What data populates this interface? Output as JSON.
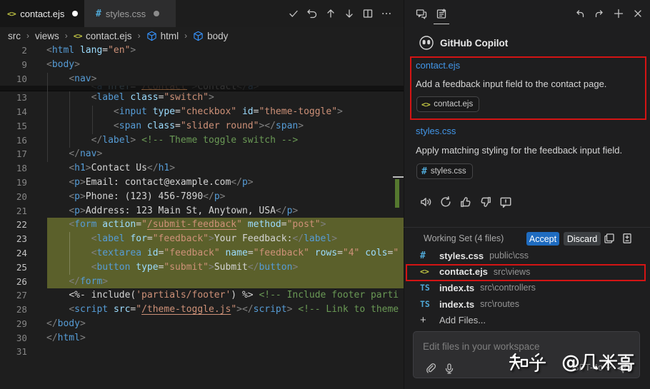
{
  "editor": {
    "tabs": [
      {
        "name": "contact.ejs",
        "icon": "ejs",
        "modified": true,
        "active": true
      },
      {
        "name": "styles.css",
        "icon": "css",
        "modified": true,
        "active": false
      }
    ],
    "toolbar_icons": [
      "check-icon",
      "discard-icon",
      "arrow-up-icon",
      "arrow-down-icon",
      "split-editor-icon",
      "more-actions-icon"
    ],
    "breadcrumb": [
      "src",
      "views",
      "contact.ejs",
      "html",
      "body"
    ],
    "breadcrumb_icons": {
      "contact.ejs": "ejs",
      "html": "cube",
      "body": "cube"
    },
    "code_lines": [
      {
        "n": "2",
        "hl": false,
        "tokens": [
          [
            "p",
            "<"
          ],
          [
            "t",
            "html"
          ],
          [
            "o",
            " "
          ],
          [
            "a",
            "lang"
          ],
          [
            "o",
            "="
          ],
          [
            "s",
            "\"en\""
          ],
          [
            "p",
            ">"
          ]
        ]
      },
      {
        "n": "9",
        "hl": false,
        "tokens": [
          [
            "p",
            "<"
          ],
          [
            "t",
            "body"
          ],
          [
            "p",
            ">"
          ]
        ]
      },
      {
        "n": "10",
        "hl": false,
        "tokens": [
          [
            "x",
            "    "
          ],
          [
            "p",
            "<"
          ],
          [
            "t",
            "nav"
          ],
          [
            "p",
            ">"
          ]
        ]
      },
      {
        "n": "13",
        "hl": false,
        "tokens": [
          [
            "x",
            "        "
          ],
          [
            "p",
            "<"
          ],
          [
            "t",
            "label"
          ],
          [
            "o",
            " "
          ],
          [
            "a",
            "class"
          ],
          [
            "o",
            "="
          ],
          [
            "s",
            "\"switch\""
          ],
          [
            "p",
            ">"
          ]
        ]
      },
      {
        "n": "14",
        "hl": false,
        "tokens": [
          [
            "x",
            "            "
          ],
          [
            "p",
            "<"
          ],
          [
            "t",
            "input"
          ],
          [
            "o",
            " "
          ],
          [
            "a",
            "type"
          ],
          [
            "o",
            "="
          ],
          [
            "s",
            "\"checkbox\""
          ],
          [
            "o",
            " "
          ],
          [
            "a",
            "id"
          ],
          [
            "o",
            "="
          ],
          [
            "s",
            "\"theme-toggle\""
          ],
          [
            "p",
            ">"
          ]
        ]
      },
      {
        "n": "15",
        "hl": false,
        "tokens": [
          [
            "x",
            "            "
          ],
          [
            "p",
            "<"
          ],
          [
            "t",
            "span"
          ],
          [
            "o",
            " "
          ],
          [
            "a",
            "class"
          ],
          [
            "o",
            "="
          ],
          [
            "s",
            "\"slider round\""
          ],
          [
            "p",
            "></"
          ],
          [
            "t",
            "span"
          ],
          [
            "p",
            ">"
          ]
        ]
      },
      {
        "n": "16",
        "hl": false,
        "tokens": [
          [
            "x",
            "        "
          ],
          [
            "p",
            "</"
          ],
          [
            "t",
            "label"
          ],
          [
            "p",
            ">"
          ],
          [
            "x",
            " "
          ],
          [
            "c",
            "<!-- Theme toggle switch -->"
          ]
        ]
      },
      {
        "n": "17",
        "hl": false,
        "tokens": [
          [
            "x",
            "    "
          ],
          [
            "p",
            "</"
          ],
          [
            "t",
            "nav"
          ],
          [
            "p",
            ">"
          ]
        ]
      },
      {
        "n": "18",
        "hl": false,
        "tokens": [
          [
            "x",
            "    "
          ],
          [
            "p",
            "<"
          ],
          [
            "t",
            "h1"
          ],
          [
            "p",
            ">"
          ],
          [
            "x",
            "Contact Us"
          ],
          [
            "p",
            "</"
          ],
          [
            "t",
            "h1"
          ],
          [
            "p",
            ">"
          ]
        ]
      },
      {
        "n": "19",
        "hl": false,
        "tokens": [
          [
            "x",
            "    "
          ],
          [
            "p",
            "<"
          ],
          [
            "t",
            "p"
          ],
          [
            "p",
            ">"
          ],
          [
            "x",
            "Email: contact@example.com"
          ],
          [
            "p",
            "</"
          ],
          [
            "t",
            "p"
          ],
          [
            "p",
            ">"
          ]
        ]
      },
      {
        "n": "20",
        "hl": false,
        "tokens": [
          [
            "x",
            "    "
          ],
          [
            "p",
            "<"
          ],
          [
            "t",
            "p"
          ],
          [
            "p",
            ">"
          ],
          [
            "x",
            "Phone: (123) 456-7890"
          ],
          [
            "p",
            "</"
          ],
          [
            "t",
            "p"
          ],
          [
            "p",
            ">"
          ]
        ]
      },
      {
        "n": "21",
        "hl": false,
        "tokens": [
          [
            "x",
            "    "
          ],
          [
            "p",
            "<"
          ],
          [
            "t",
            "p"
          ],
          [
            "p",
            ">"
          ],
          [
            "x",
            "Address: 123 Main St, Anytown, USA"
          ],
          [
            "p",
            "</"
          ],
          [
            "t",
            "p"
          ],
          [
            "p",
            ">"
          ]
        ]
      },
      {
        "n": "22",
        "hl": true,
        "tokens": [
          [
            "x",
            "    "
          ],
          [
            "p",
            "<"
          ],
          [
            "t",
            "form"
          ],
          [
            "o",
            " "
          ],
          [
            "a",
            "action"
          ],
          [
            "o",
            "="
          ],
          [
            "s",
            "\""
          ],
          [
            "u",
            "/submit-feedback"
          ],
          [
            "s",
            "\""
          ],
          [
            "o",
            " "
          ],
          [
            "a",
            "method"
          ],
          [
            "o",
            "="
          ],
          [
            "s",
            "\"post\""
          ],
          [
            "p",
            ">"
          ]
        ]
      },
      {
        "n": "23",
        "hl": true,
        "tokens": [
          [
            "x",
            "        "
          ],
          [
            "p",
            "<"
          ],
          [
            "t",
            "label"
          ],
          [
            "o",
            " "
          ],
          [
            "a",
            "for"
          ],
          [
            "o",
            "="
          ],
          [
            "s",
            "\"feedback\""
          ],
          [
            "p",
            ">"
          ],
          [
            "x",
            "Your Feedback:"
          ],
          [
            "p",
            "</"
          ],
          [
            "t",
            "label"
          ],
          [
            "p",
            ">"
          ]
        ]
      },
      {
        "n": "24",
        "hl": true,
        "tokens": [
          [
            "x",
            "        "
          ],
          [
            "p",
            "<"
          ],
          [
            "t",
            "textarea"
          ],
          [
            "o",
            " "
          ],
          [
            "a",
            "id"
          ],
          [
            "o",
            "="
          ],
          [
            "s",
            "\"feedback\""
          ],
          [
            "o",
            " "
          ],
          [
            "a",
            "name"
          ],
          [
            "o",
            "="
          ],
          [
            "s",
            "\"feedback\""
          ],
          [
            "o",
            " "
          ],
          [
            "a",
            "rows"
          ],
          [
            "o",
            "="
          ],
          [
            "s",
            "\"4\""
          ],
          [
            "o",
            " "
          ],
          [
            "a",
            "cols"
          ],
          [
            "o",
            "="
          ],
          [
            "s",
            "\""
          ]
        ]
      },
      {
        "n": "25",
        "hl": true,
        "tokens": [
          [
            "x",
            "        "
          ],
          [
            "p",
            "<"
          ],
          [
            "t",
            "button"
          ],
          [
            "o",
            " "
          ],
          [
            "a",
            "type"
          ],
          [
            "o",
            "="
          ],
          [
            "s",
            "\"submit\""
          ],
          [
            "p",
            ">"
          ],
          [
            "x",
            "Submit"
          ],
          [
            "p",
            "</"
          ],
          [
            "t",
            "button"
          ],
          [
            "p",
            ">"
          ]
        ]
      },
      {
        "n": "26",
        "hl": true,
        "tokens": [
          [
            "x",
            "    "
          ],
          [
            "p",
            "</"
          ],
          [
            "t",
            "form"
          ],
          [
            "p",
            ">"
          ]
        ]
      },
      {
        "n": "27",
        "hl": false,
        "tokens": [
          [
            "x",
            "    "
          ],
          [
            "x",
            "<%- include("
          ],
          [
            "s",
            "'partials/footer'"
          ],
          [
            "x",
            ") %> "
          ],
          [
            "c",
            "<!-- Include footer parti"
          ]
        ]
      },
      {
        "n": "28",
        "hl": false,
        "tokens": [
          [
            "x",
            "    "
          ],
          [
            "p",
            "<"
          ],
          [
            "t",
            "script"
          ],
          [
            "o",
            " "
          ],
          [
            "a",
            "src"
          ],
          [
            "o",
            "="
          ],
          [
            "s",
            "\""
          ],
          [
            "u",
            "/theme-toggle.js"
          ],
          [
            "s",
            "\""
          ],
          [
            "p",
            "></"
          ],
          [
            "t",
            "script"
          ],
          [
            "p",
            ">"
          ],
          [
            "x",
            " "
          ],
          [
            "c",
            "<!-- Link to theme"
          ]
        ]
      },
      {
        "n": "29",
        "hl": false,
        "tokens": [
          [
            "p",
            "</"
          ],
          [
            "t",
            "body"
          ],
          [
            "p",
            ">"
          ]
        ]
      },
      {
        "n": "30",
        "hl": false,
        "tokens": [
          [
            "p",
            "</"
          ],
          [
            "t",
            "html"
          ],
          [
            "p",
            ">"
          ]
        ]
      },
      {
        "n": "31",
        "hl": false,
        "tokens": []
      }
    ],
    "obscured_line_tokens": [
      [
        "x",
        "        "
      ],
      [
        "p",
        "<"
      ],
      [
        "t",
        "a"
      ],
      [
        "o",
        " "
      ],
      [
        "a",
        "href"
      ],
      [
        "o",
        "="
      ],
      [
        "s",
        "\""
      ],
      [
        "u",
        "/contact"
      ],
      [
        "s",
        "\""
      ],
      [
        "p",
        ">"
      ],
      [
        "x",
        "Contact"
      ],
      [
        "p",
        "</"
      ],
      [
        "t",
        "a"
      ],
      [
        "p",
        ">"
      ]
    ]
  },
  "copilot": {
    "header_icons_left": [
      "chat-icon",
      "copilot-edits-icon"
    ],
    "header_icons_right": [
      "undo-icon",
      "redo-icon",
      "new-session-icon",
      "close-icon"
    ],
    "title": "GitHub Copilot",
    "requests": [
      {
        "file_link": "contact.ejs",
        "prompt": "Add a feedback input field to the contact page.",
        "chip": {
          "icon": "ejs",
          "label": "contact.ejs"
        },
        "annotated": true
      },
      {
        "file_link": "styles.css",
        "prompt": "Apply matching styling for the feedback input field.",
        "chip": {
          "icon": "css",
          "label": "styles.css"
        },
        "annotated": false
      }
    ],
    "feedback_icons": [
      "read-aloud-icon",
      "retry-icon",
      "thumbs-up-icon",
      "thumbs-down-icon",
      "report-icon"
    ],
    "working_set": {
      "title": "Working Set (4 files)",
      "accept_label": "Accept",
      "discard_label": "Discard",
      "header_icons": [
        "save-all-icon",
        "view-diff-icon"
      ],
      "files": [
        {
          "icon": "css",
          "name": "styles.css",
          "path": "public\\css",
          "annotated": false
        },
        {
          "icon": "ejs",
          "name": "contact.ejs",
          "path": "src\\views",
          "annotated": true
        },
        {
          "icon": "ts",
          "name": "index.ts",
          "path": "src\\controllers",
          "annotated": false
        },
        {
          "icon": "ts",
          "name": "index.ts",
          "path": "src\\routes",
          "annotated": false
        }
      ],
      "add_files_label": "Add Files..."
    },
    "input": {
      "placeholder": "Edit files in your workspace",
      "icons": [
        "attach-icon",
        "mic-icon"
      ],
      "model": "GPT-4o",
      "send_icon": "send-icon"
    }
  },
  "watermark": {
    "text": "知乎 @几米哥"
  },
  "colors": {
    "editor_bg": "#1e1e1e",
    "panel_bg": "#1f1f20",
    "highlight_added": "#5b602b",
    "accent_blue": "#4296e8",
    "accept_button": "#1f6cc0",
    "annotation_red": "#d41414"
  }
}
